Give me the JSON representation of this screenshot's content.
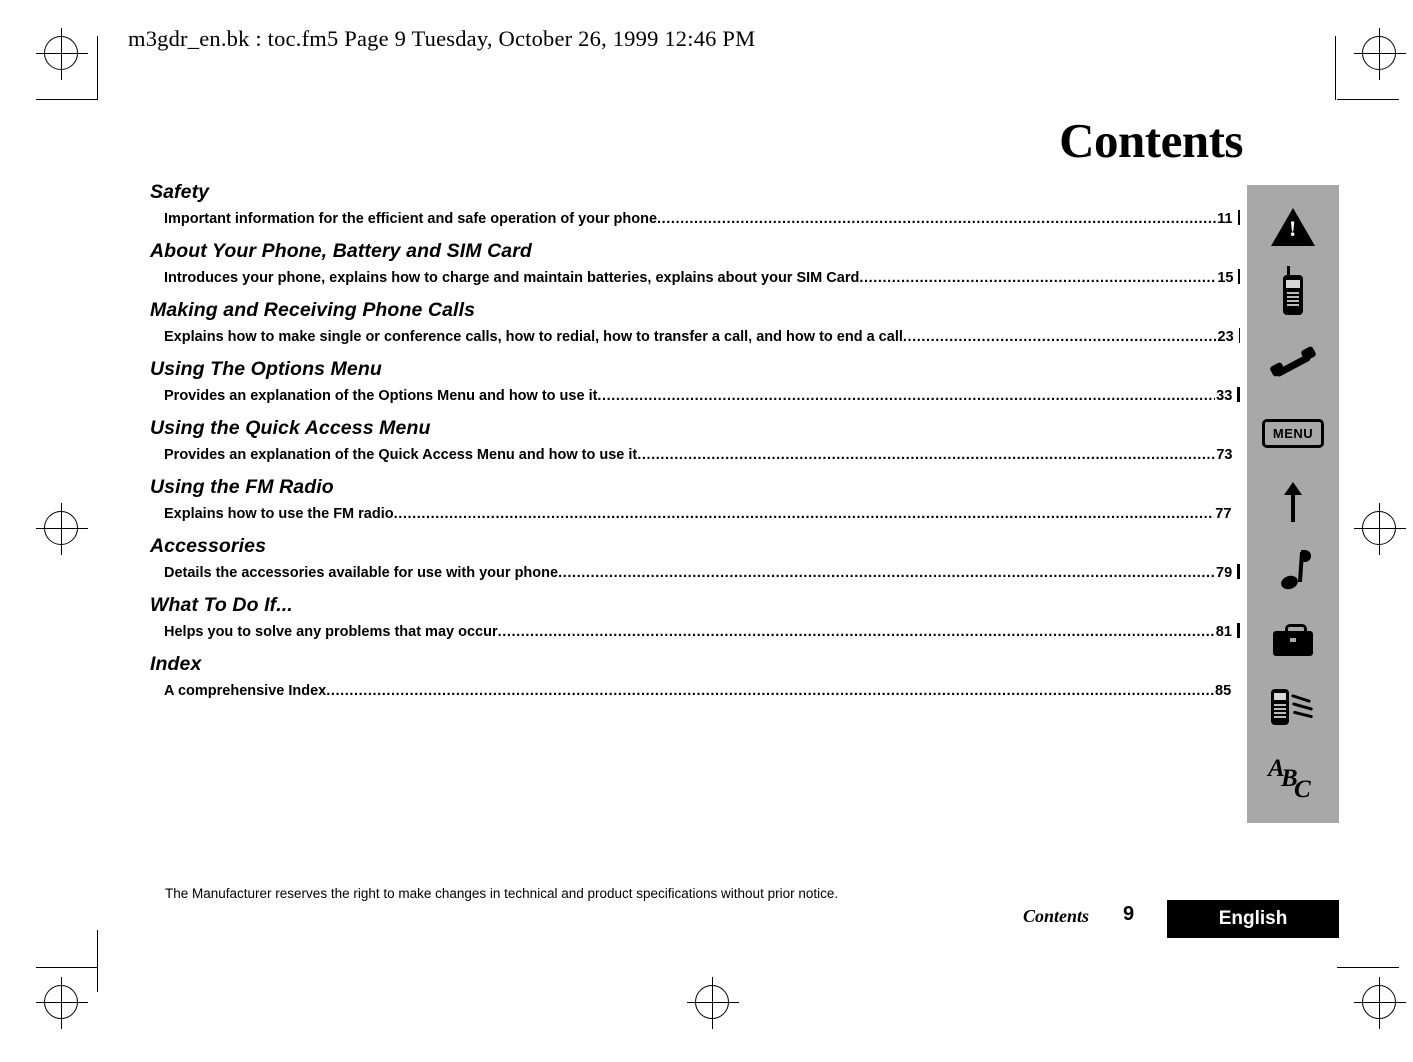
{
  "header": {
    "file_line": "m3gdr_en.bk : toc.fm5  Page 9  Tuesday, October 26, 1999  12:46 PM"
  },
  "page": {
    "title": "Contents"
  },
  "toc": {
    "entries": [
      {
        "chapter": "Safety",
        "description": "Important information for the efficient and safe operation of your phone",
        "page": "11",
        "tab": true
      },
      {
        "chapter": "About Your Phone, Battery and SIM Card",
        "description": "Introduces your phone, explains how to charge and maintain batteries, explains about your SIM Card",
        "page": "15",
        "tab": true
      },
      {
        "chapter": "Making and Receiving Phone Calls",
        "description": "Explains how to make single or conference calls, how to redial, how to transfer a call, and how to end a call",
        "page": "23",
        "tab": true
      },
      {
        "chapter": "Using The Options Menu",
        "description": "Provides an explanation of the Options Menu and how to use it",
        "page": "33",
        "tab": true
      },
      {
        "chapter": "Using the Quick Access Menu",
        "description": "Provides an explanation of the Quick Access Menu and how to use it",
        "page": "73",
        "tab": false
      },
      {
        "chapter": "Using the FM Radio",
        "description": "Explains how to use the FM radio ",
        "page": "77",
        "tab": false
      },
      {
        "chapter": "Accessories",
        "description": "Details the accessories available for use with your phone",
        "page": "79",
        "tab": true
      },
      {
        "chapter": "What To Do If...",
        "description": "Helps you to solve any problems that may occur",
        "page": "81",
        "tab": true
      },
      {
        "chapter": "Index",
        "description": "A comprehensive Index ",
        "page": "85",
        "tab": false
      }
    ],
    "dot_leader": "......................................................................................................................................................................................................."
  },
  "sidebar": {
    "icons": [
      {
        "name": "warning-triangle-icon",
        "label": "!"
      },
      {
        "name": "phone-icon",
        "label": ""
      },
      {
        "name": "handset-call-icon",
        "label": ""
      },
      {
        "name": "menu-icon",
        "label": "MENU"
      },
      {
        "name": "up-arrow-icon",
        "label": ""
      },
      {
        "name": "music-note-icon",
        "label": ""
      },
      {
        "name": "accessories-bag-icon",
        "label": ""
      },
      {
        "name": "phone-troubleshoot-icon",
        "label": ""
      },
      {
        "name": "abc-index-icon",
        "label": "ABC"
      }
    ]
  },
  "footer": {
    "note": "The Manufacturer reserves the right to make changes in technical and product specifications without prior notice.",
    "section": "Contents",
    "page_number": "9",
    "language": "English"
  }
}
